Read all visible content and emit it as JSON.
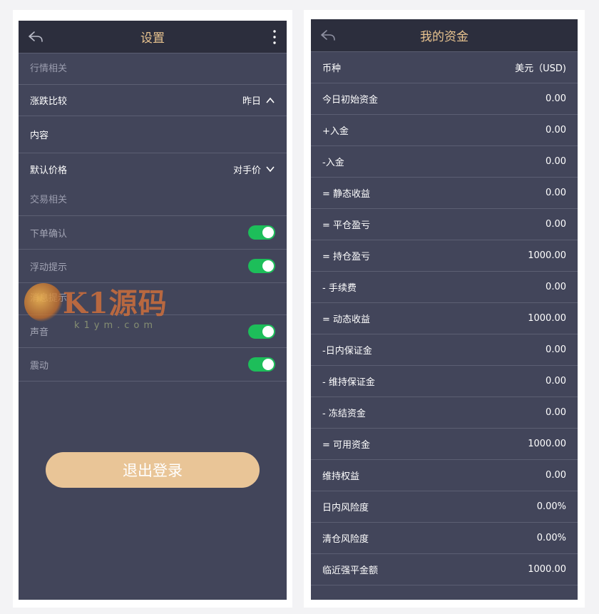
{
  "settings": {
    "title": "设置",
    "market_section": "行情相关",
    "rows": {
      "change_compare": {
        "label": "涨跌比较",
        "value": "昨日"
      },
      "content": {
        "label": "内容"
      },
      "default_price": {
        "label": "默认价格",
        "value": "对手价"
      }
    },
    "trade_section": "交易相关",
    "order_confirm": "下单确认",
    "float_tip": "浮动提示",
    "message_section": "消息提示",
    "sound": "声音",
    "vibrate": "震动",
    "toggles": {
      "order_confirm": true,
      "float_tip": true,
      "sound": true,
      "vibrate": true
    },
    "logout": "退出登录",
    "watermark": {
      "brand": "K1源码",
      "url": "k1ym.com"
    }
  },
  "funds": {
    "title": "我的资金",
    "rows": [
      {
        "label": "币种",
        "value": "美元（USD)"
      },
      {
        "label": "今日初始资金",
        "value": "0.00"
      },
      {
        "label": "+入金",
        "value": "0.00"
      },
      {
        "label": "-入金",
        "value": "0.00"
      },
      {
        "label": "= 静态收益",
        "value": "0.00"
      },
      {
        "label": "= 平仓盈亏",
        "value": "0.00"
      },
      {
        "label": "= 持仓盈亏",
        "value": "1000.00"
      },
      {
        "label": "- 手续费",
        "value": "0.00"
      },
      {
        "label": "= 动态收益",
        "value": "1000.00"
      },
      {
        "label": "-日内保证金",
        "value": "0.00"
      },
      {
        "label": "- 维持保证金",
        "value": "0.00"
      },
      {
        "label": "- 冻结资金",
        "value": "0.00"
      },
      {
        "label": "= 可用资金",
        "value": "1000.00"
      },
      {
        "label": "维持权益",
        "value": "0.00"
      },
      {
        "label": "日内风险度",
        "value": "0.00%"
      },
      {
        "label": "清仓风险度",
        "value": "0.00%"
      },
      {
        "label": "临近强平金额",
        "value": "1000.00"
      }
    ]
  },
  "colors": {
    "accent": "#e8c38f",
    "toggle_on": "#1dbe5a",
    "panel": "#42455a",
    "header": "#2c2e3d"
  },
  "icons": {
    "back": "back-arrow-icon",
    "more": "more-vertical-icon",
    "chevron_up": "chevron-up-icon",
    "chevron_down": "chevron-down-icon"
  }
}
